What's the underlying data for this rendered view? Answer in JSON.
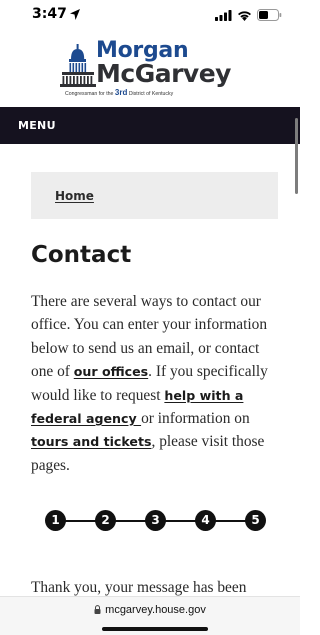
{
  "status_bar": {
    "time": "3:47"
  },
  "header": {
    "logo_first": "Morgan",
    "logo_last": "McGarvey",
    "tagline_pre": "Congressman for the",
    "tagline_big": "3rd",
    "tagline_post": "District of Kentucky"
  },
  "menu": {
    "label": "MENU"
  },
  "breadcrumb": {
    "home": "Home"
  },
  "page": {
    "title": "Contact",
    "intro_1": "There are several ways to contact our office. You can enter your information below to send us an email, or contact one of ",
    "link_offices": "our offices",
    "intro_2": ". If you specifically would like to request ",
    "link_agency": "help with a federal agency ",
    "intro_3": "or information on ",
    "link_tours": "tours and tickets",
    "intro_4": ", please visit those pages.",
    "thanks": "Thank you, your message has been"
  },
  "steps": [
    "1",
    "2",
    "3",
    "4",
    "5"
  ],
  "url_bar": {
    "url": "mcgarvey.house.gov"
  },
  "colors": {
    "menu_bg": "#15121f",
    "brand_blue": "#1d4a8f",
    "breadcrumb_bg": "#ededed"
  }
}
